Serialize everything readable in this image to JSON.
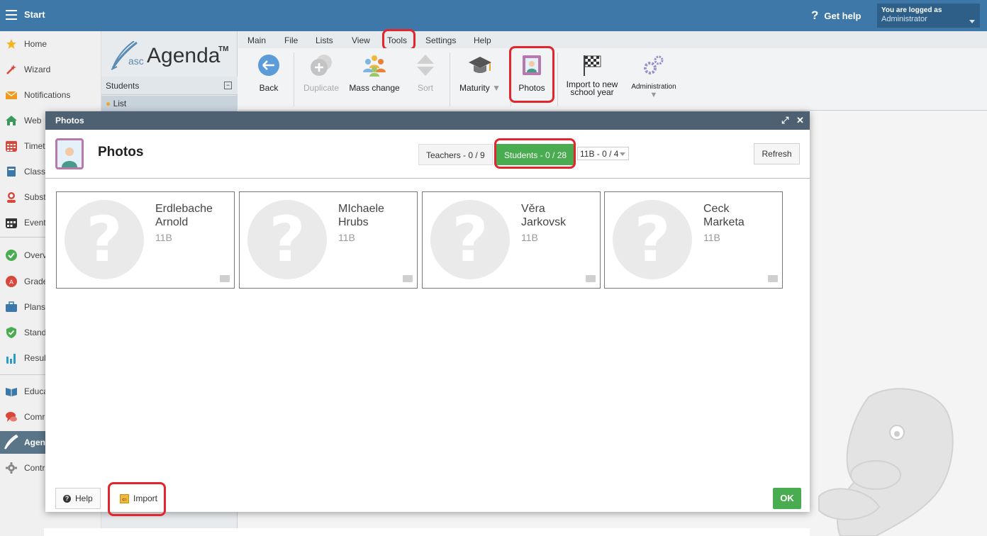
{
  "topbar": {
    "start_label": "Start",
    "help_label": "Get help",
    "logged_line1": "You are logged as",
    "logged_line2": "Administrator"
  },
  "sidebar": {
    "items": [
      {
        "label": "Home",
        "icon": "star-icon",
        "color": "#f2b51d"
      },
      {
        "label": "Wizard",
        "icon": "wand-icon",
        "color": "#d9473b"
      },
      {
        "label": "Notifications",
        "icon": "envelope-icon",
        "color": "#f29a1d"
      },
      {
        "label": "Web",
        "icon": "house-icon",
        "color": "#3b9a5b"
      },
      {
        "label": "Timet",
        "icon": "calendar-grid-icon",
        "color": "#d9473b"
      },
      {
        "label": "Class",
        "icon": "book-icon",
        "color": "#3d78a8"
      },
      {
        "label": "Subst",
        "icon": "person-icon",
        "color": "#d9473b"
      },
      {
        "label": "Event",
        "icon": "calendar-icon",
        "color": "#333333"
      },
      {
        "label": "Overv",
        "icon": "check-circle-icon",
        "color": "#4aac50"
      },
      {
        "label": "Grade",
        "icon": "grade-icon",
        "color": "#d9473b"
      },
      {
        "label": "Plans",
        "icon": "briefcase-icon",
        "color": "#3d78a8"
      },
      {
        "label": "Stand",
        "icon": "shield-icon",
        "color": "#4aac50"
      },
      {
        "label": "Resul",
        "icon": "bar-chart-icon",
        "color": "#2e9cc9"
      },
      {
        "label": "Educa",
        "icon": "open-book-icon",
        "color": "#3d78a8"
      },
      {
        "label": "Comr",
        "icon": "chat-icon",
        "color": "#d9473b"
      },
      {
        "label": "Agen",
        "icon": "pen-icon",
        "color": "#ffffff"
      },
      {
        "label": "Contr",
        "icon": "gear-icon",
        "color": "#888888"
      }
    ]
  },
  "col2": {
    "logo_asc": "asc",
    "logo_agenda": "Agenda",
    "logo_tm": "TM",
    "students_header": "Students",
    "list_label": "List"
  },
  "menu": [
    "Main",
    "File",
    "Lists",
    "View",
    "Tools",
    "Settings",
    "Help"
  ],
  "toolbar": {
    "back": "Back",
    "duplicate": "Duplicate",
    "mass_change": "Mass change",
    "sort": "Sort",
    "maturity": "Maturity",
    "photos": "Photos",
    "import_line1": "Import to new",
    "import_line2": "school year",
    "administration": "Administration"
  },
  "modal": {
    "title": "Photos",
    "heading": "Photos",
    "teachers_tab": "Teachers - 0 / 9",
    "students_tab": "Students - 0 / 28",
    "class_select": "11B - 0 / 4",
    "refresh": "Refresh",
    "cards": [
      {
        "name1": "Erdlebache",
        "name2": "Arnold",
        "class": "11B"
      },
      {
        "name1": "MIchaele",
        "name2": "Hrubs",
        "class": "11B"
      },
      {
        "name1": "Věra",
        "name2": "Jarkovsk",
        "class": "11B"
      },
      {
        "name1": "Ceck",
        "name2": "Marketa",
        "class": "11B"
      }
    ],
    "help_btn": "Help",
    "import_btn": "Import",
    "ok_btn": "OK"
  },
  "colors": {
    "topbar": "#3d78a8",
    "highlight": "#e3262d",
    "green": "#4aac50",
    "modal_title": "#4e6173"
  }
}
